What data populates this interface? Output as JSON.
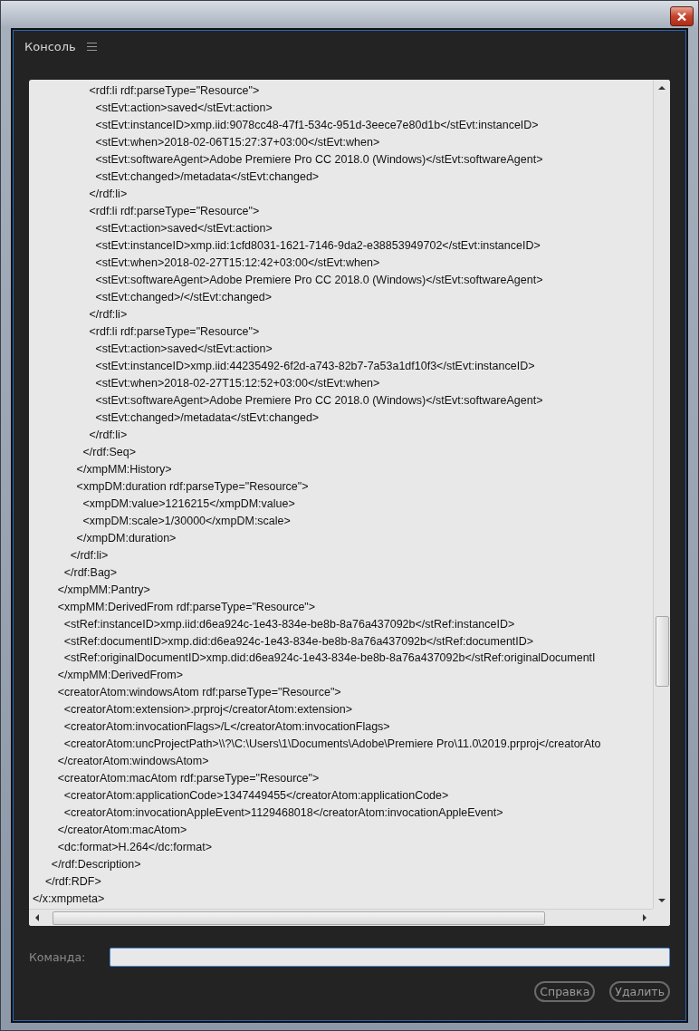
{
  "panel": {
    "title": "Консоль"
  },
  "console": {
    "lines": [
      "                  <rdf:li rdf:parseType=\"Resource\">",
      "                    <stEvt:action>saved</stEvt:action>",
      "                    <stEvt:instanceID>xmp.iid:9078cc48-47f1-534c-951d-3eece7e80d1b</stEvt:instanceID>",
      "                    <stEvt:when>2018-02-06T15:27:37+03:00</stEvt:when>",
      "                    <stEvt:softwareAgent>Adobe Premiere Pro CC 2018.0 (Windows)</stEvt:softwareAgent>",
      "                    <stEvt:changed>/metadata</stEvt:changed>",
      "                  </rdf:li>",
      "                  <rdf:li rdf:parseType=\"Resource\">",
      "                    <stEvt:action>saved</stEvt:action>",
      "                    <stEvt:instanceID>xmp.iid:1cfd8031-1621-7146-9da2-e38853949702</stEvt:instanceID>",
      "                    <stEvt:when>2018-02-27T15:12:42+03:00</stEvt:when>",
      "                    <stEvt:softwareAgent>Adobe Premiere Pro CC 2018.0 (Windows)</stEvt:softwareAgent>",
      "                    <stEvt:changed>/</stEvt:changed>",
      "                  </rdf:li>",
      "                  <rdf:li rdf:parseType=\"Resource\">",
      "                    <stEvt:action>saved</stEvt:action>",
      "                    <stEvt:instanceID>xmp.iid:44235492-6f2d-a743-82b7-7a53a1df10f3</stEvt:instanceID>",
      "                    <stEvt:when>2018-02-27T15:12:52+03:00</stEvt:when>",
      "                    <stEvt:softwareAgent>Adobe Premiere Pro CC 2018.0 (Windows)</stEvt:softwareAgent>",
      "                    <stEvt:changed>/metadata</stEvt:changed>",
      "                  </rdf:li>",
      "                </rdf:Seq>",
      "              </xmpMM:History>",
      "              <xmpDM:duration rdf:parseType=\"Resource\">",
      "                <xmpDM:value>1216215</xmpDM:value>",
      "                <xmpDM:scale>1/30000</xmpDM:scale>",
      "              </xmpDM:duration>",
      "            </rdf:li>",
      "          </rdf:Bag>",
      "        </xmpMM:Pantry>",
      "        <xmpMM:DerivedFrom rdf:parseType=\"Resource\">",
      "          <stRef:instanceID>xmp.iid:d6ea924c-1e43-834e-be8b-8a76a437092b</stRef:instanceID>",
      "          <stRef:documentID>xmp.did:d6ea924c-1e43-834e-be8b-8a76a437092b</stRef:documentID>",
      "          <stRef:originalDocumentID>xmp.did:d6ea924c-1e43-834e-be8b-8a76a437092b</stRef:originalDocumentI",
      "        </xmpMM:DerivedFrom>",
      "        <creatorAtom:windowsAtom rdf:parseType=\"Resource\">",
      "          <creatorAtom:extension>.prproj</creatorAtom:extension>",
      "          <creatorAtom:invocationFlags>/L</creatorAtom:invocationFlags>",
      "          <creatorAtom:uncProjectPath>\\\\?\\C:\\Users\\1\\Documents\\Adobe\\Premiere Pro\\11.0\\2019.prproj</creatorAto",
      "        </creatorAtom:windowsAtom>",
      "        <creatorAtom:macAtom rdf:parseType=\"Resource\">",
      "          <creatorAtom:applicationCode>1347449455</creatorAtom:applicationCode>",
      "          <creatorAtom:invocationAppleEvent>1129468018</creatorAtom:invocationAppleEvent>",
      "        </creatorAtom:macAtom>",
      "        <dc:format>H.264</dc:format>",
      "      </rdf:Description>",
      "    </rdf:RDF>",
      "</x:xmpmeta>"
    ]
  },
  "command": {
    "label": "Команда:"
  },
  "buttons": [
    "Справка",
    "Удалить"
  ]
}
